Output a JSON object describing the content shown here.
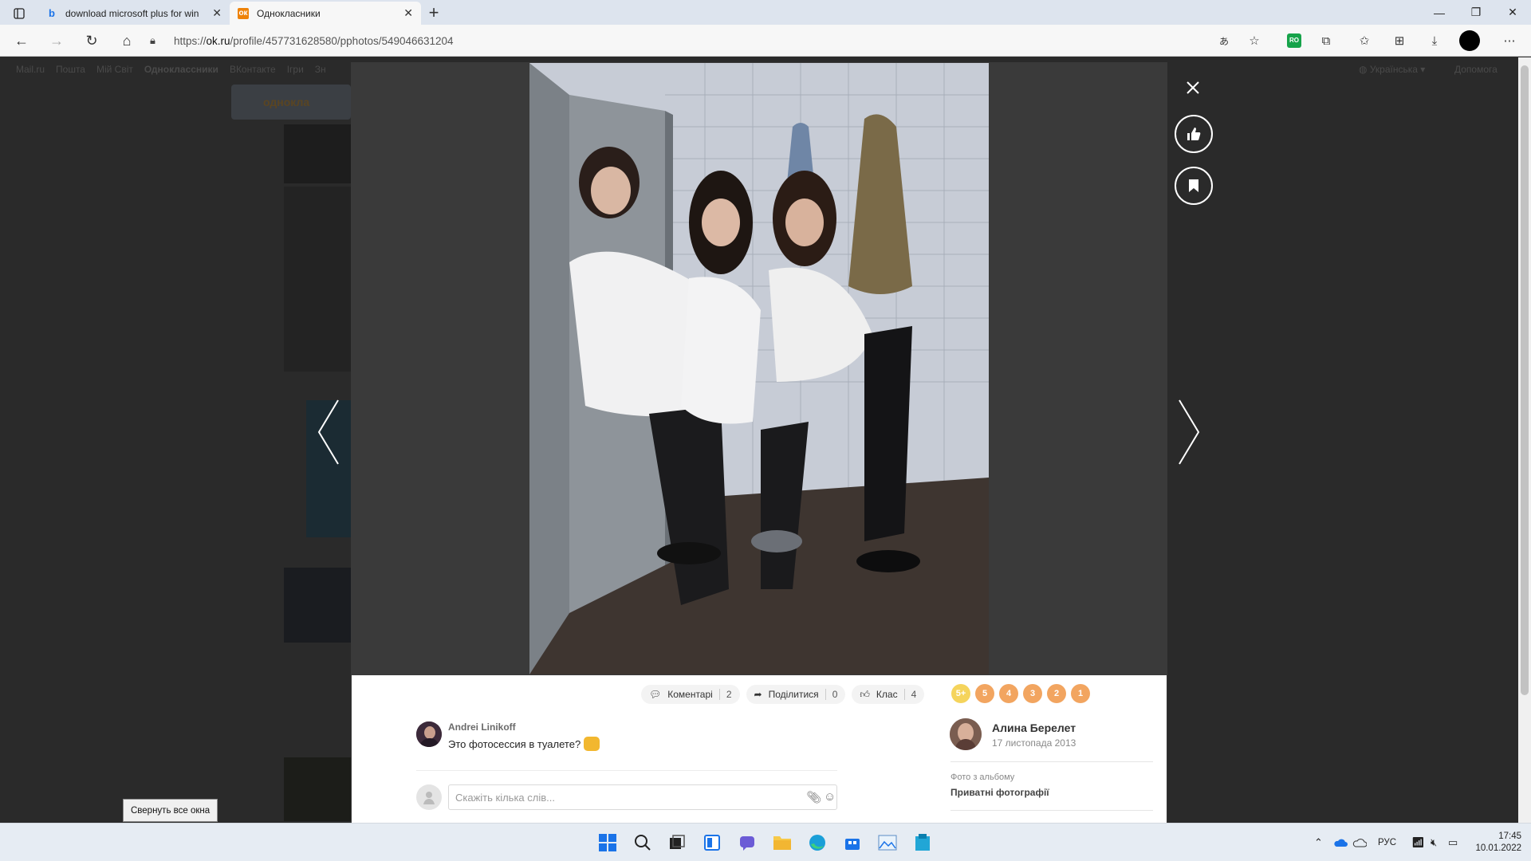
{
  "browser": {
    "tabs": [
      {
        "title": "download microsoft plus for win",
        "favicon": "bing-icon",
        "active": false
      },
      {
        "title": "Однокласники",
        "favicon": "ok-icon",
        "active": true
      }
    ],
    "url_prefix": "https://",
    "url_host": "ok.ru",
    "url_path": "/profile/457731628580/pphotos/549046631204"
  },
  "bgpage": {
    "nav": [
      "Mail.ru",
      "Пошта",
      "Мій Світ",
      "Одноклассники",
      "ВКонтакте",
      "Ігри",
      "Зн"
    ],
    "lang": "Українська",
    "help": "Допомога",
    "logo_text": "однокла"
  },
  "viewer": {
    "actions": {
      "comments_label": "Коментарі",
      "comments_count": "2",
      "share_label": "Поділитися",
      "share_count": "0",
      "like_label": "Клас",
      "like_count": "4"
    },
    "grades": [
      "5+",
      "5",
      "4",
      "3",
      "2",
      "1"
    ],
    "owner": {
      "name": "Алина Берелет",
      "date": "17 листопада 2013"
    },
    "album": {
      "label": "Фото з альбому",
      "name": "Приватні фотографії"
    },
    "comment": {
      "author": "Andrei Linikoff",
      "text": "Это фотосессия в туалете?"
    },
    "comment_input": {
      "placeholder": "Скажіть кілька слів..."
    }
  },
  "tooltip": "Свернуть все окна",
  "taskbar": {
    "tray_lang": "РУС",
    "time": "17:45",
    "date": "10.01.2022"
  },
  "colors": {
    "grade_orange": "#f2a560",
    "grade_top": "#f5d45c",
    "ok_orange": "#ee8208"
  }
}
